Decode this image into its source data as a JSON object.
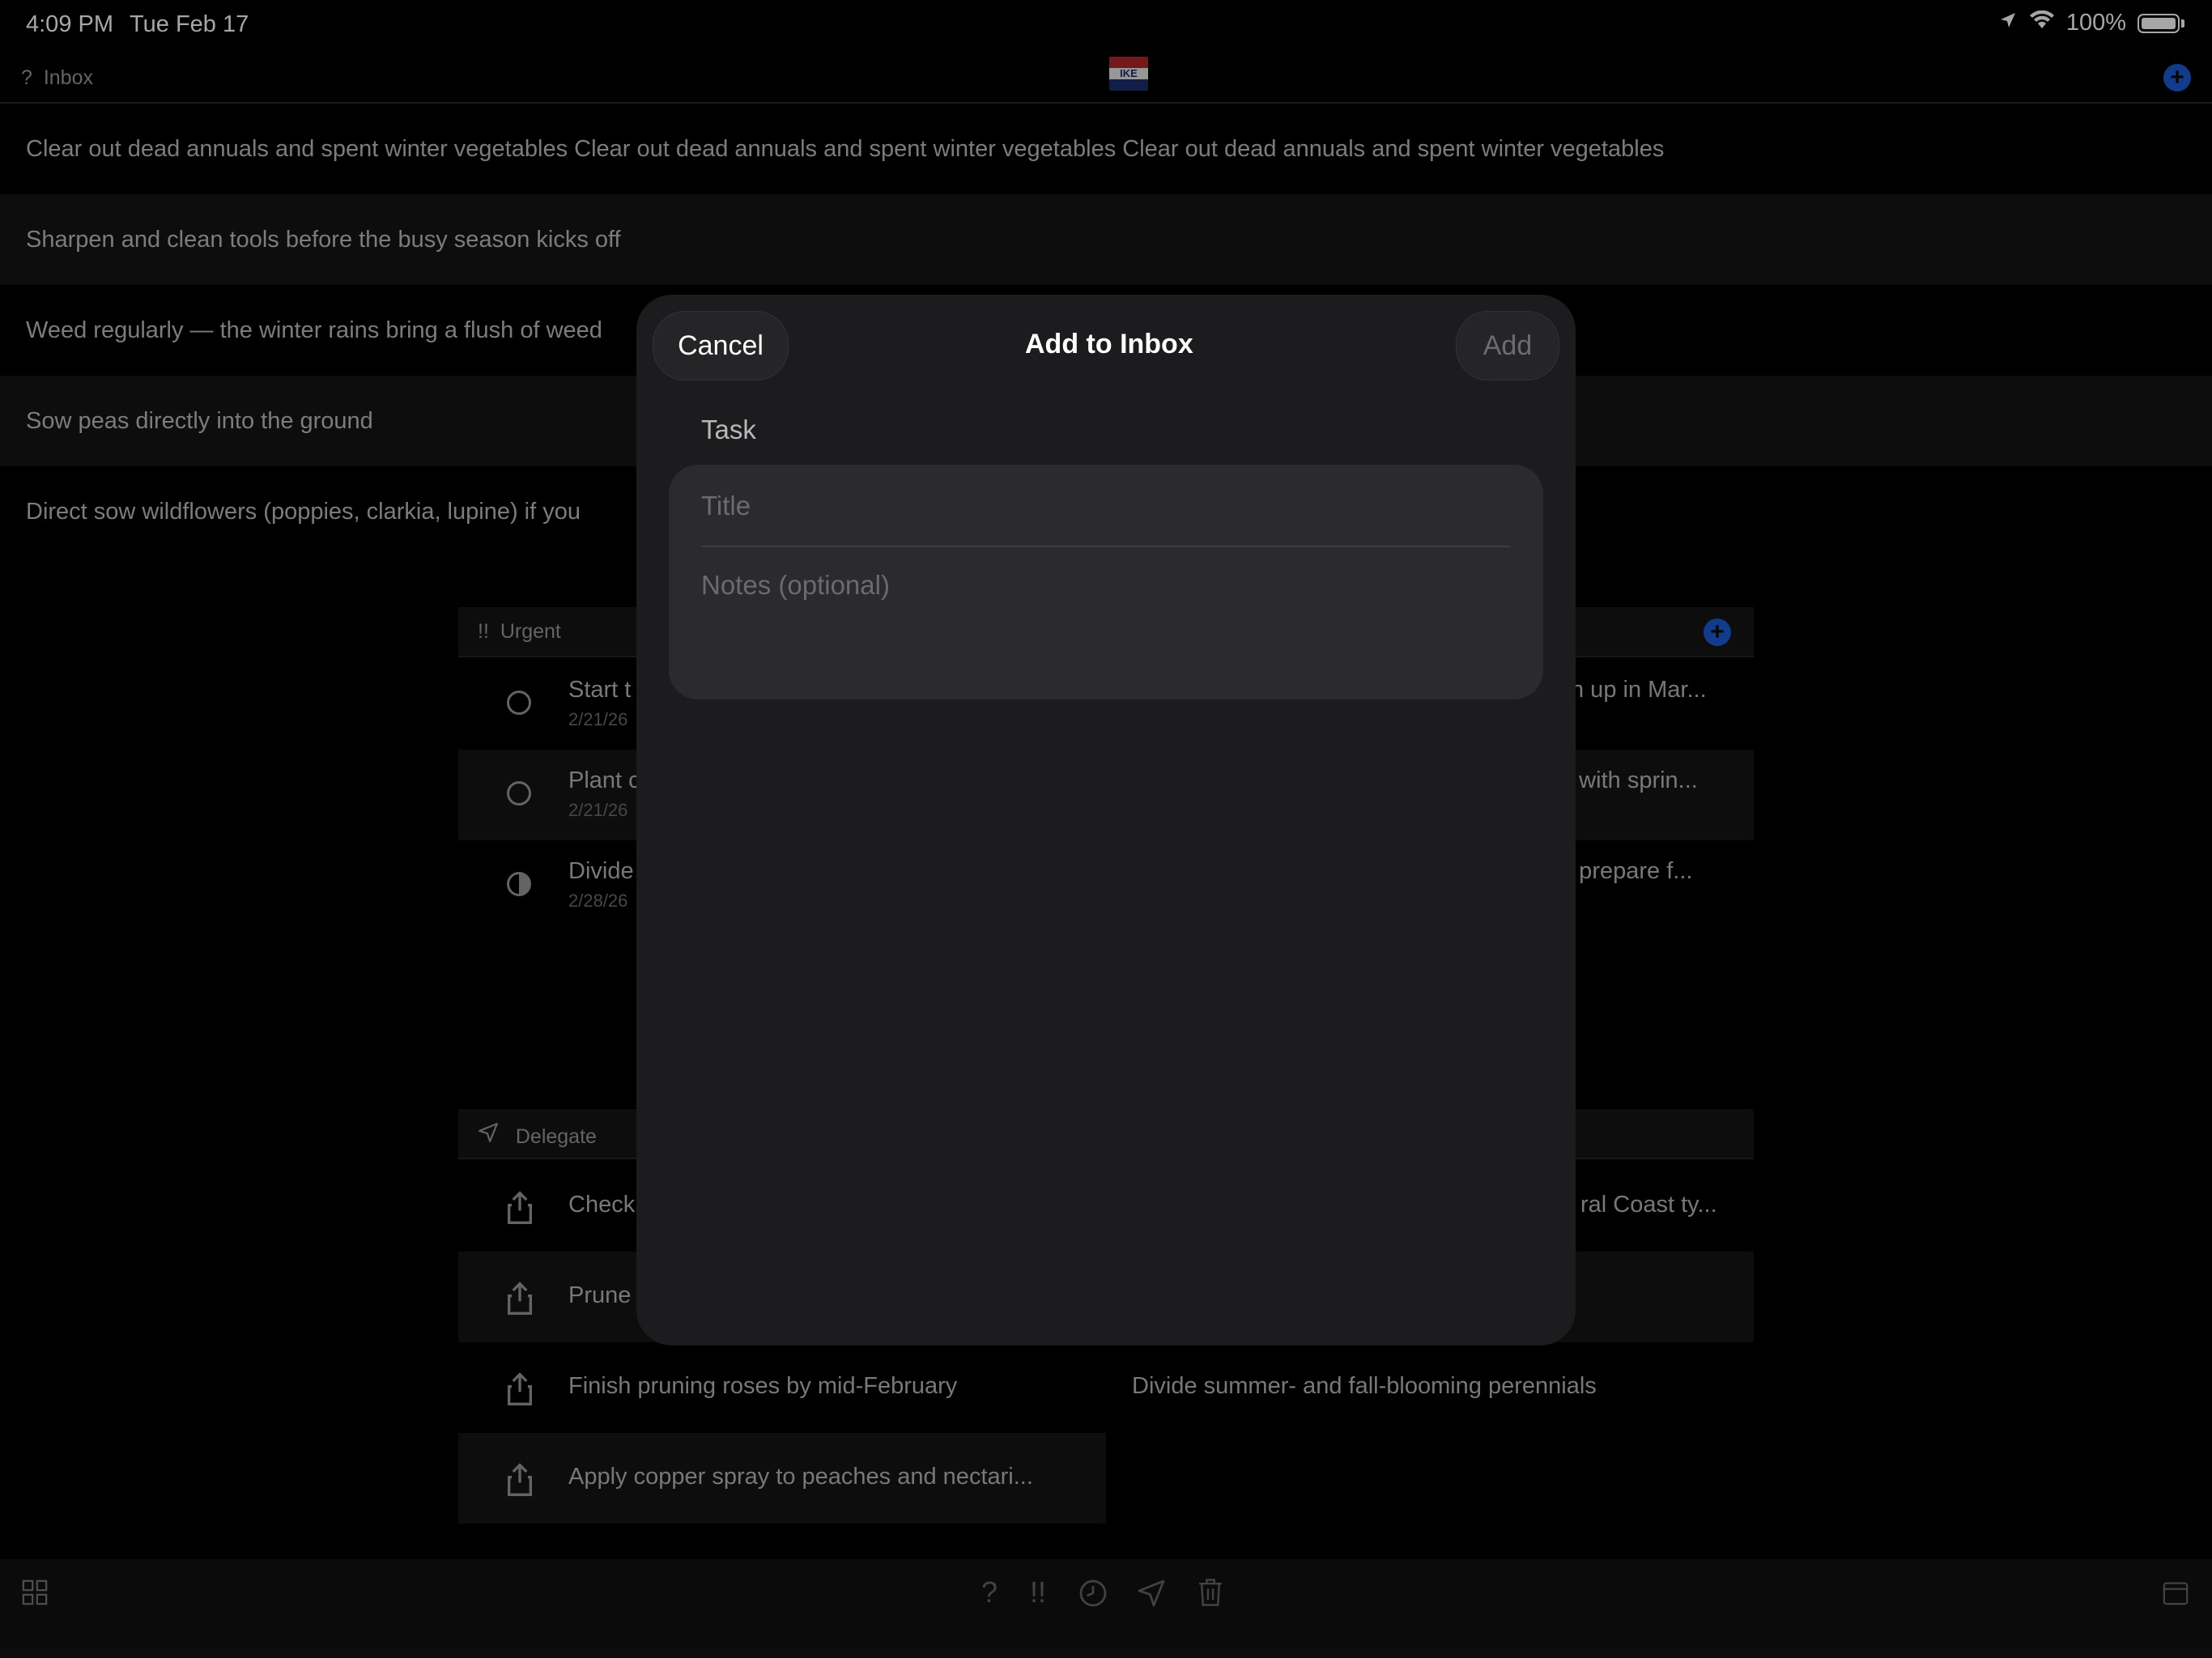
{
  "status_bar": {
    "time": "4:09 PM",
    "date": "Tue Feb 17",
    "battery": "100%"
  },
  "inbox": {
    "icon": "?",
    "title": "Inbox",
    "rows": [
      "Clear out dead annuals and spent winter vegetables Clear out dead annuals and spent winter vegetables Clear out dead annuals and spent winter vegetables",
      "Sharpen and clean tools before the busy season kicks off",
      "Weed regularly — the winter rains bring a flush of weed",
      "Sow peas directly into the ground",
      "Direct sow wildflowers (poppies, clarkia, lupine) if you"
    ]
  },
  "logo": {
    "text": "IKE"
  },
  "urgent": {
    "icon": "!!",
    "title": "Urgent",
    "rows": [
      {
        "title": "Start t",
        "date": "2/21/26",
        "right": "n up in Mar..."
      },
      {
        "title": "Plant c",
        "date": "2/21/26",
        "right": "o with sprin..."
      },
      {
        "title": "Divide",
        "date": "2/28/26",
        "right": "o prepare f..."
      }
    ]
  },
  "delegate": {
    "title": "Delegate",
    "rows": [
      {
        "title": "Check",
        "right": "ral Coast ty..."
      },
      {
        "title": "Prune",
        "right": ""
      },
      {
        "title": "Finish pruning roses by mid-February",
        "right": "Divide summer- and fall-blooming perennials"
      },
      {
        "title": "Apply copper spray to peaches and nectari...",
        "right": ""
      }
    ]
  },
  "modal": {
    "cancel": "Cancel",
    "title": "Add to Inbox",
    "add": "Add",
    "section_label": "Task",
    "title_placeholder": "Title",
    "notes_placeholder": "Notes (optional)"
  },
  "toolbar": {
    "icons": [
      "grid-icon",
      "question-icon",
      "urgent-icon",
      "clock-icon",
      "send-icon",
      "trash-icon",
      "calendar-icon"
    ]
  },
  "colors": {
    "accent": "#1e5bd6",
    "background": "#000000",
    "modal": "#1c1c1e"
  }
}
